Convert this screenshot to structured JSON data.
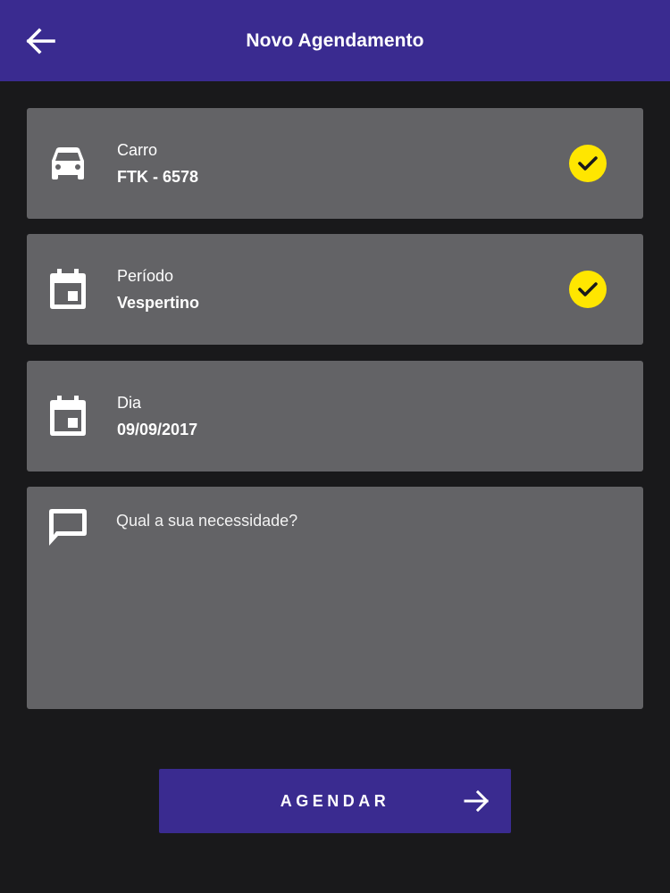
{
  "header": {
    "title": "Novo Agendamento",
    "back_icon": "arrow-left-icon"
  },
  "fields": [
    {
      "label": "Carro",
      "value": "FTK - 6578",
      "icon": "car-icon",
      "completed": true
    },
    {
      "label": "Período",
      "value": "Vespertino",
      "icon": "calendar-icon",
      "completed": true
    },
    {
      "label": "Dia",
      "value": "09/09/2017",
      "icon": "calendar-icon",
      "completed": false
    }
  ],
  "notes": {
    "placeholder": "Qual a sua necessidade?",
    "value": "",
    "icon": "comment-icon"
  },
  "submit": {
    "label": "AGENDAR",
    "icon": "arrow-right-icon"
  },
  "colors": {
    "primary": "#3a2b90",
    "background": "#19191b",
    "card": "#636366",
    "check_badge": "#ffe600"
  }
}
